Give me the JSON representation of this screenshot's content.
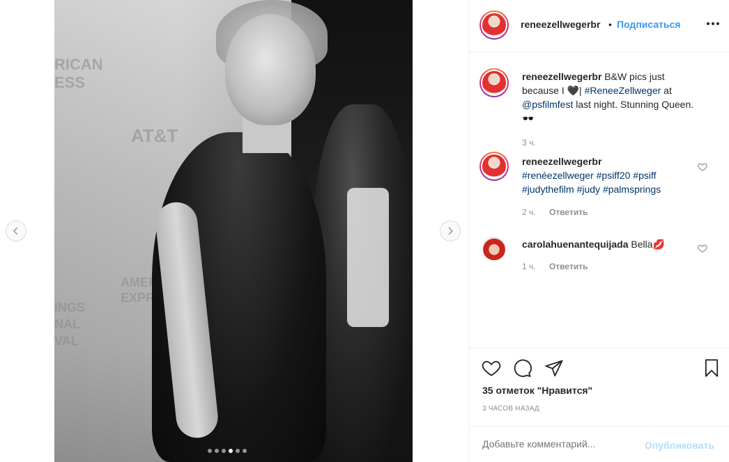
{
  "post": {
    "author": "reneezellwegerbr",
    "separator": "•",
    "follow_label": "Подписаться",
    "carousel": {
      "slides": 6,
      "active": 4
    }
  },
  "caption": {
    "author": "reneezellwegerbr",
    "text_a": "B&W pics just because I 🖤| ",
    "tag1": "#ReneeZellweger",
    "text_b": " at ",
    "tag2": "@psfilmfest",
    "text_c": " last night. Stunning Queen.🕶️",
    "time": "3 ч."
  },
  "comments": [
    {
      "author": "reneezellwegerbr",
      "tags": "#renéezellweger #psiff20 #psiff #judythefilm #judy #palmsprings",
      "time": "2 ч.",
      "reply": "Ответить"
    },
    {
      "author": "carolahuenantequijada",
      "text": "Bella💋",
      "time": "1 ч.",
      "reply": "Ответить"
    }
  ],
  "likes_text": "35 отметок \"Нравится\"",
  "post_time": "3 часов назад",
  "add_comment": {
    "placeholder": "Добавьте комментарий...",
    "publish_label": "Опубликовать"
  },
  "colors": {
    "link": "#3897f0",
    "hashtag": "#003569",
    "muted": "#8e8e8e",
    "publish_disabled": "#b2dffc"
  }
}
